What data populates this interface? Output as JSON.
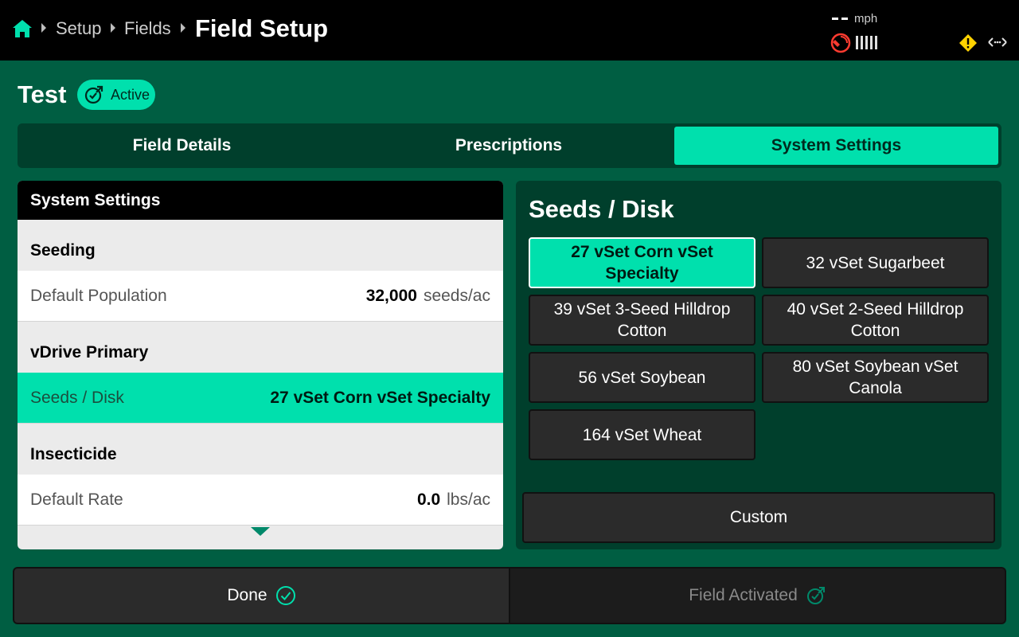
{
  "topbar": {
    "breadcrumbs": [
      "Setup",
      "Fields"
    ],
    "current": "Field Setup",
    "speed_value": "--",
    "speed_unit": "mph"
  },
  "field": {
    "name": "Test",
    "status": "Active"
  },
  "tabs": [
    {
      "label": "Field Details",
      "active": false
    },
    {
      "label": "Prescriptions",
      "active": false
    },
    {
      "label": "System Settings",
      "active": true
    }
  ],
  "left_panel": {
    "title": "System Settings",
    "sections": [
      {
        "heading": "Seeding",
        "rows": [
          {
            "label": "Default Population",
            "value": "32,000",
            "unit": "seeds/ac"
          }
        ]
      },
      {
        "heading": "vDrive Primary",
        "rows": [
          {
            "label": "Seeds / Disk",
            "value": "27 vSet Corn vSet Specialty",
            "unit": ""
          }
        ]
      },
      {
        "heading": "Insecticide",
        "rows": [
          {
            "label": "Default Rate",
            "value": "0.0",
            "unit": "lbs/ac"
          }
        ]
      }
    ]
  },
  "right_panel": {
    "title": "Seeds / Disk",
    "options": [
      {
        "label": "27 vSet Corn vSet Specialty",
        "selected": true
      },
      {
        "label": "32 vSet Sugarbeet",
        "selected": false
      },
      {
        "label": "39 vSet 3-Seed Hilldrop Cotton",
        "selected": false
      },
      {
        "label": "40 vSet 2-Seed Hilldrop Cotton",
        "selected": false
      },
      {
        "label": "56 vSet Soybean",
        "selected": false
      },
      {
        "label": "80 vSet Soybean vSet Canola",
        "selected": false
      },
      {
        "label": "164 vSet Wheat",
        "selected": false
      }
    ],
    "custom_label": "Custom"
  },
  "bottom": {
    "done_label": "Done",
    "activated_label": "Field Activated"
  },
  "colors": {
    "accent": "#00e0ad",
    "background": "#005e42",
    "panel_dark": "#003f2c",
    "warning": "#ffd200",
    "alert": "#ff3b30"
  }
}
